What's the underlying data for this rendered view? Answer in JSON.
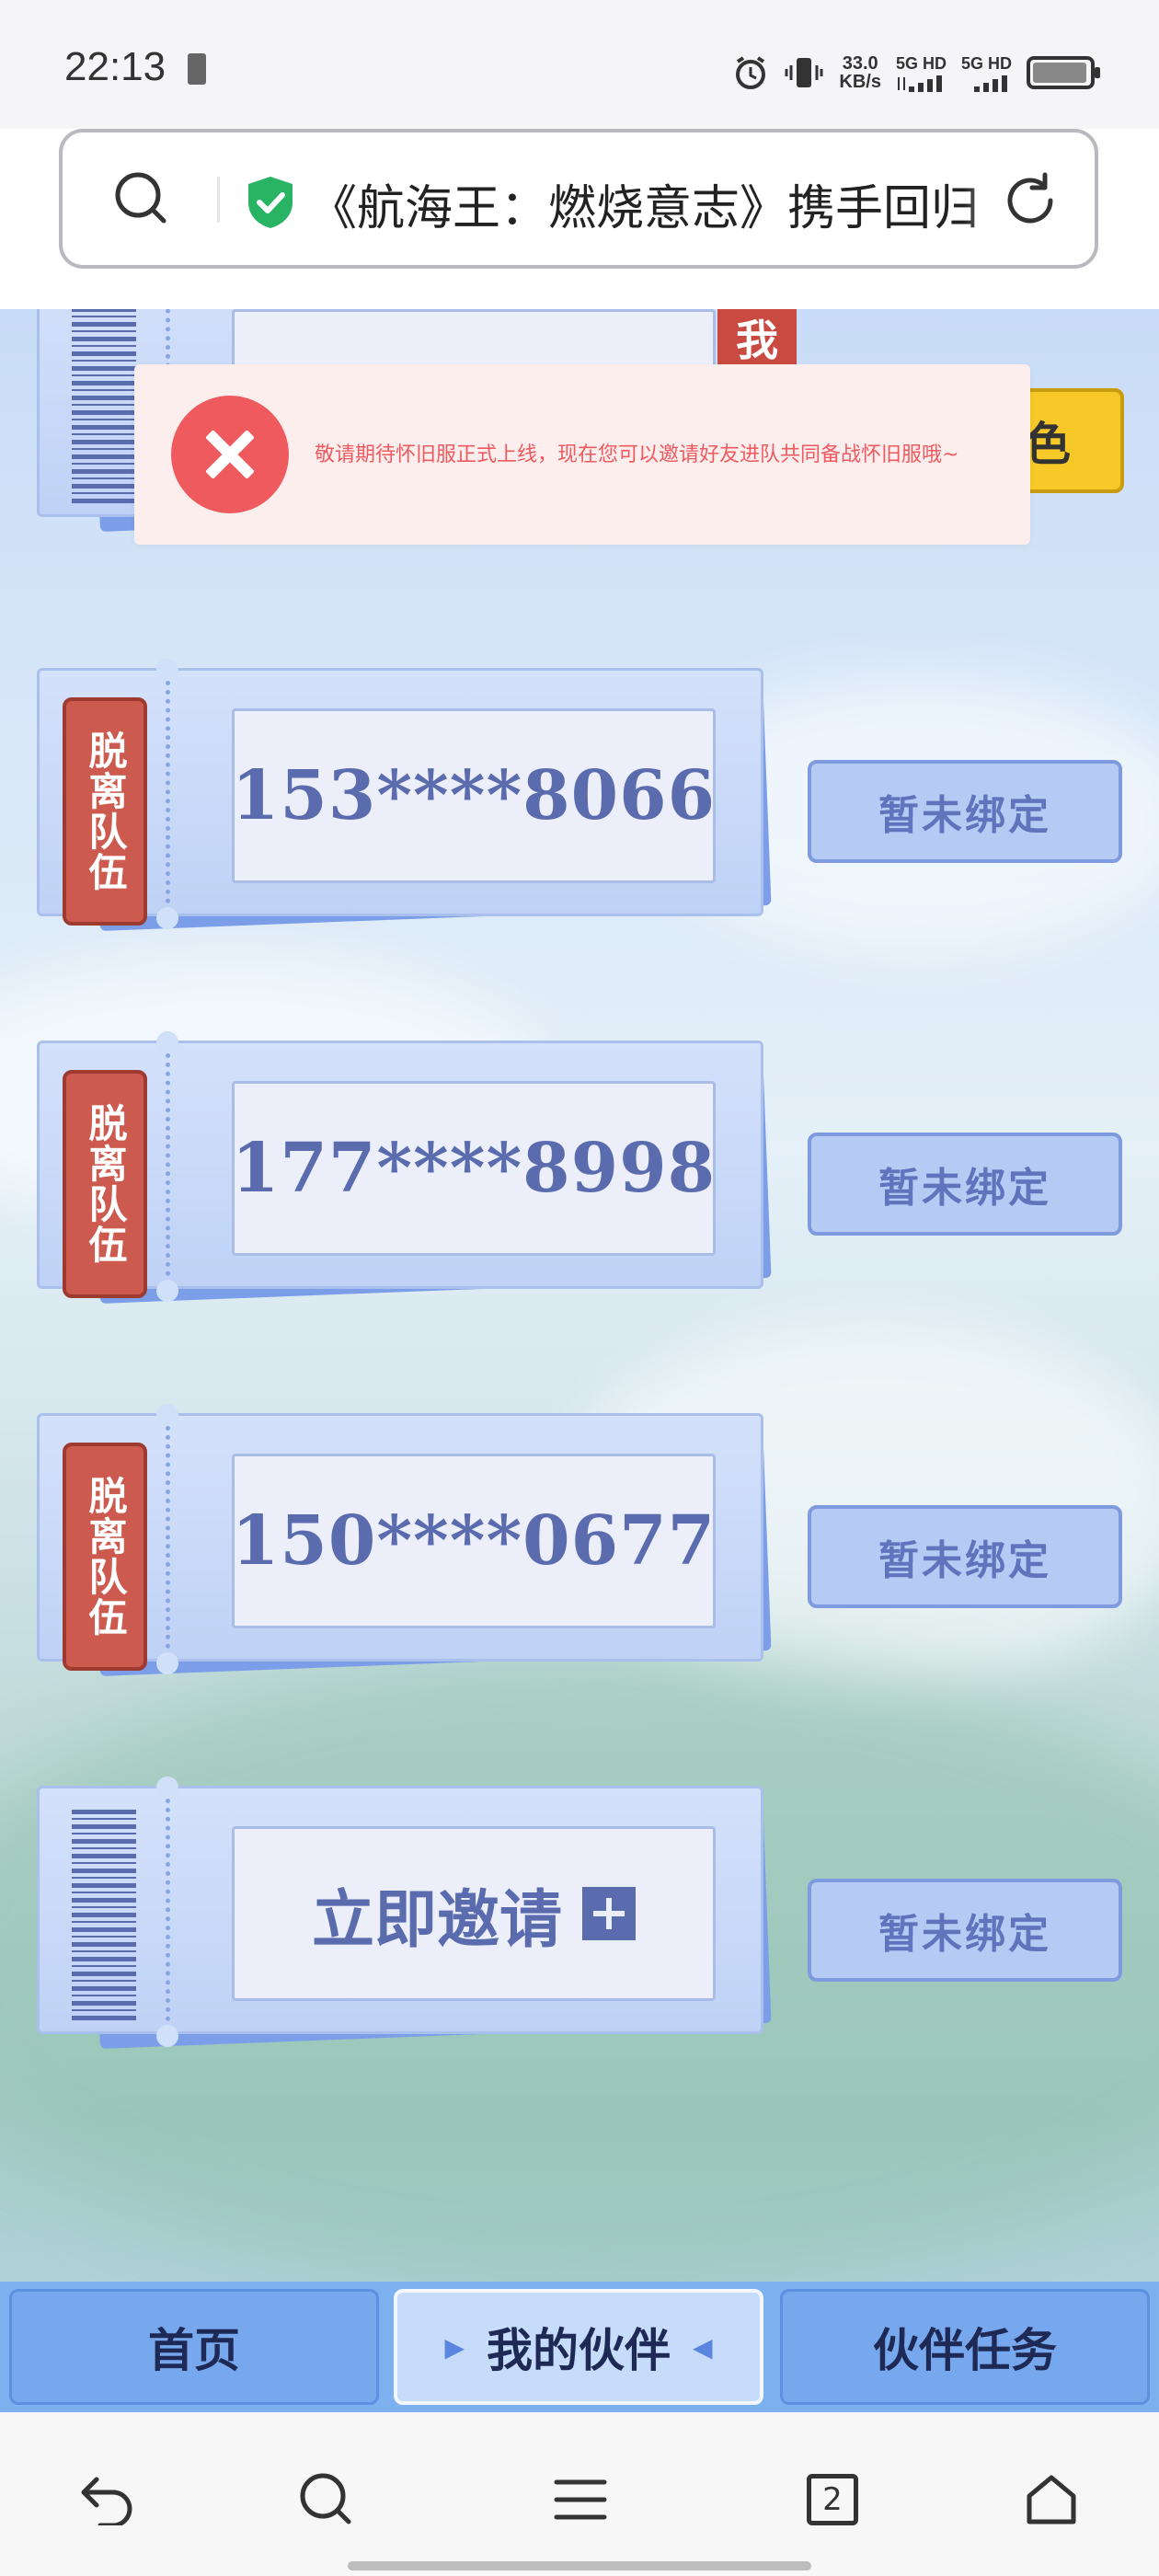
{
  "status": {
    "time": "22:13",
    "speed_value": "33.0",
    "speed_unit": "KB/s",
    "net1": "5G HD",
    "net2": "5G HD"
  },
  "browser": {
    "url_title": "《航海王：燃烧意志》携手回归",
    "secure": true
  },
  "toast": {
    "message": "敬请期待怀旧服正式上线，现在您可以邀请好友进队共同备战怀旧服哦~"
  },
  "top_ticket": {
    "me_tag": "我",
    "yellow_button": "色"
  },
  "members": [
    {
      "phone": "153****8066",
      "leave_label": "脱离队伍",
      "bind_status": "暂未绑定"
    },
    {
      "phone": "177****8998",
      "leave_label": "脱离队伍",
      "bind_status": "暂未绑定"
    },
    {
      "phone": "150****0677",
      "leave_label": "脱离队伍",
      "bind_status": "暂未绑定"
    }
  ],
  "invite_slot": {
    "label": "立即邀请",
    "bind_status": "暂未绑定"
  },
  "tabs": {
    "home": "首页",
    "partners": "我的伙伴",
    "tasks": "伙伴任务",
    "active": "partners"
  },
  "navbar": {
    "tab_count": "2"
  },
  "colors": {
    "accent_red": "#cd5a4e",
    "ticket_blue": "#bfd2f6",
    "tab_blue": "#77a8ee",
    "toast_red": "#ef5a5f",
    "yellow": "#f6c928"
  }
}
